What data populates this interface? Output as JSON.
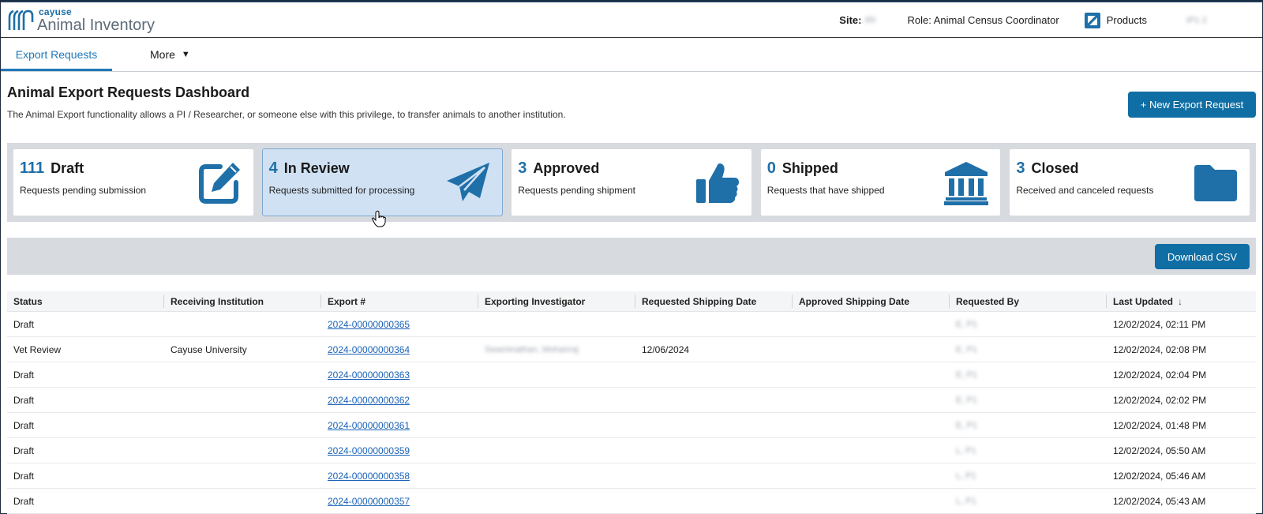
{
  "app": {
    "brand": "cayuse",
    "product": "Animal Inventory"
  },
  "header": {
    "site_label": "Site:",
    "site_value": "IRI",
    "role": "Role: Animal Census Coordinator",
    "products_label": "Products",
    "products_icon": "products-icon",
    "user": "IP1 2"
  },
  "nav": {
    "tabs": [
      {
        "label": "Export Requests",
        "active": true
      }
    ],
    "more_label": "More",
    "more_caret": "▼"
  },
  "page": {
    "title": "Animal Export Requests Dashboard",
    "description": "The Animal Export functionality allows a PI / Researcher, or someone else with this privilege, to transfer animals to another institution.",
    "new_request_label": "+ New Export Request"
  },
  "cards": [
    {
      "count": "111",
      "name": "Draft",
      "subtitle": "Requests pending submission",
      "icon": "edit-icon",
      "active": false
    },
    {
      "count": "4",
      "name": "In Review",
      "subtitle": "Requests submitted for processing",
      "icon": "paper-plane-icon",
      "active": true
    },
    {
      "count": "3",
      "name": "Approved",
      "subtitle": "Requests pending shipment",
      "icon": "thumbs-up-icon",
      "active": false
    },
    {
      "count": "0",
      "name": "Shipped",
      "subtitle": "Requests that have shipped",
      "icon": "institution-icon",
      "active": false
    },
    {
      "count": "3",
      "name": "Closed",
      "subtitle": "Received and canceled requests",
      "icon": "folder-icon",
      "active": false
    }
  ],
  "toolbar": {
    "download_label": "Download CSV"
  },
  "table": {
    "columns": [
      "Status",
      "Receiving Institution",
      "Export #",
      "Exporting Investigator",
      "Requested Shipping Date",
      "Approved Shipping Date",
      "Requested By",
      "Last Updated"
    ],
    "sort_indicator": "↓",
    "rows": [
      {
        "status": "Draft",
        "institution": "",
        "export_no": "2024-00000000365",
        "investigator": "",
        "req_date": "",
        "appr_date": "",
        "requested_by": "E, P1",
        "updated": "12/02/2024, 02:11 PM"
      },
      {
        "status": "Vet Review",
        "institution": "Cayuse University",
        "export_no": "2024-00000000364",
        "investigator": "Swaminathan, Mohanraj",
        "req_date": "12/06/2024",
        "appr_date": "",
        "requested_by": "E, P1",
        "updated": "12/02/2024, 02:08 PM"
      },
      {
        "status": "Draft",
        "institution": "",
        "export_no": "2024-00000000363",
        "investigator": "",
        "req_date": "",
        "appr_date": "",
        "requested_by": "E, P1",
        "updated": "12/02/2024, 02:04 PM"
      },
      {
        "status": "Draft",
        "institution": "",
        "export_no": "2024-00000000362",
        "investigator": "",
        "req_date": "",
        "appr_date": "",
        "requested_by": "E, P1",
        "updated": "12/02/2024, 02:02 PM"
      },
      {
        "status": "Draft",
        "institution": "",
        "export_no": "2024-00000000361",
        "investigator": "",
        "req_date": "",
        "appr_date": "",
        "requested_by": "E, P1",
        "updated": "12/02/2024, 01:48 PM"
      },
      {
        "status": "Draft",
        "institution": "",
        "export_no": "2024-00000000359",
        "investigator": "",
        "req_date": "",
        "appr_date": "",
        "requested_by": "L, P1",
        "updated": "12/02/2024, 05:50 AM"
      },
      {
        "status": "Draft",
        "institution": "",
        "export_no": "2024-00000000358",
        "investigator": "",
        "req_date": "",
        "appr_date": "",
        "requested_by": "L, P1",
        "updated": "12/02/2024, 05:46 AM"
      },
      {
        "status": "Draft",
        "institution": "",
        "export_no": "2024-00000000357",
        "investigator": "",
        "req_date": "",
        "appr_date": "",
        "requested_by": "L, P1",
        "updated": "12/02/2024, 05:43 AM"
      }
    ]
  },
  "colors": {
    "accent": "#0f6ea3",
    "link": "#1b63b7",
    "active_card": "#cfe1f3",
    "panel_bg": "#d7dbe0"
  }
}
